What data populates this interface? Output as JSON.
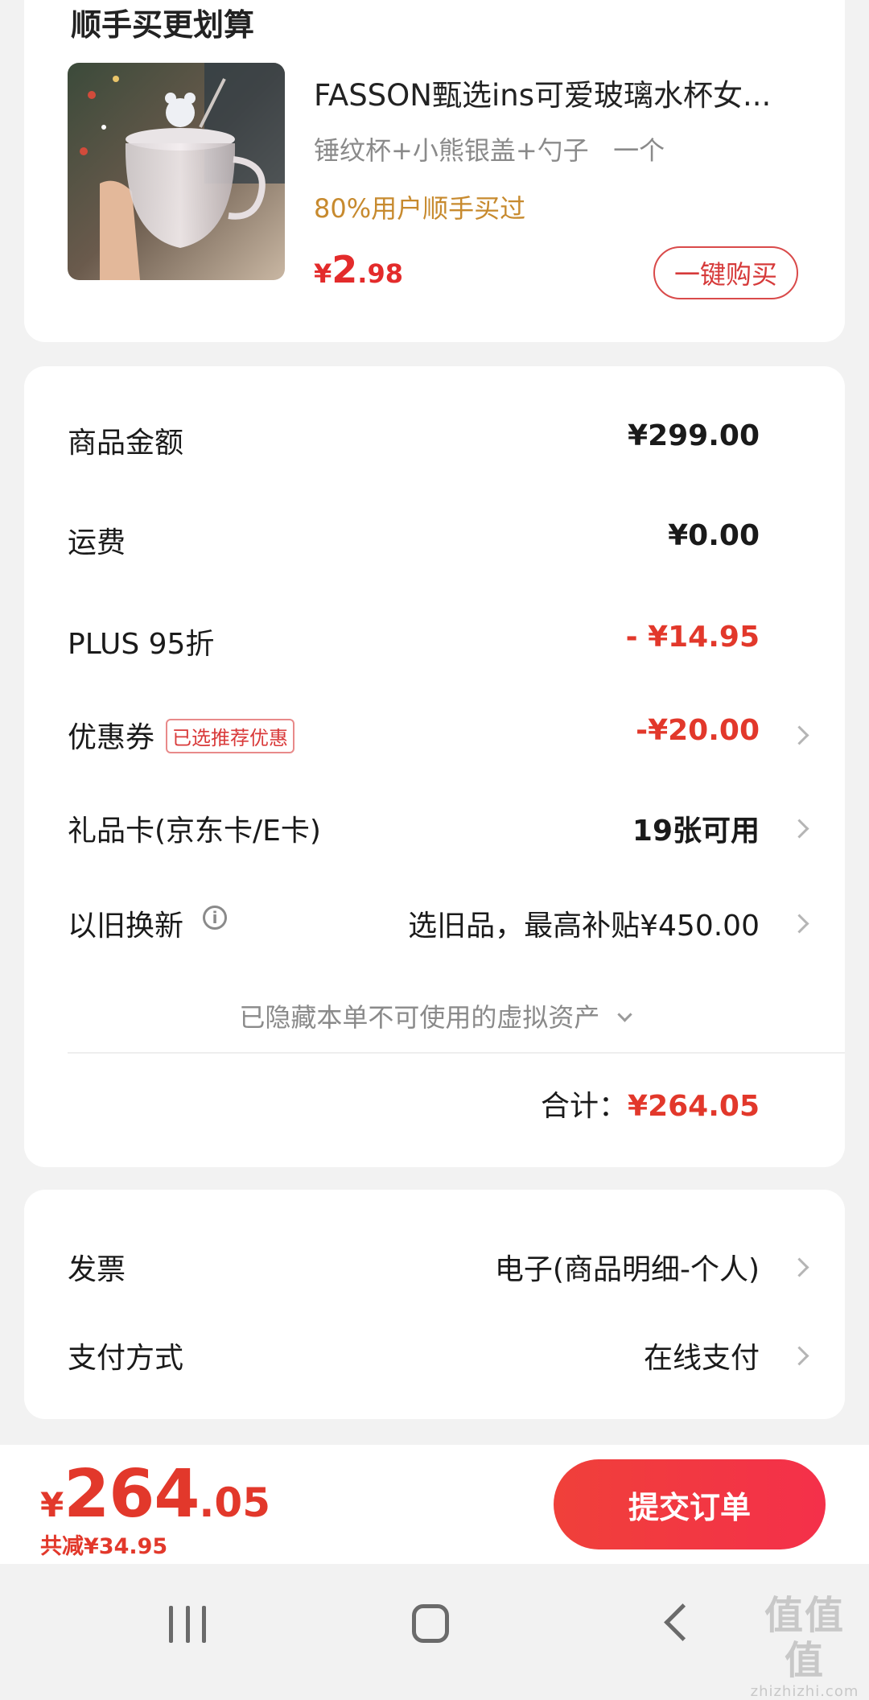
{
  "addon": {
    "section_title": "顺手买更划算",
    "product": {
      "name": "FASSON甄选ins可爱玻璃水杯女...",
      "spec": "锤纹杯+小熊银盖+勺子   一个",
      "social_proof": "80%用户顺手买过",
      "price_symbol": "¥",
      "price_integer": "2",
      "price_decimal": ".98",
      "buy_button": "一键购买"
    }
  },
  "summary": {
    "goods_amount": {
      "label": "商品金额",
      "value": "¥299.00"
    },
    "shipping": {
      "label": "运费",
      "value": "¥0.00"
    },
    "plus_discount": {
      "label": "PLUS 95折",
      "value": "- ¥14.95"
    },
    "coupon": {
      "label": "优惠券",
      "tag": "已选推荐优惠",
      "value": "-¥20.00"
    },
    "gift_card": {
      "label": "礼品卡(京东卡/E卡)",
      "value": "19张可用"
    },
    "trade_in": {
      "label": "以旧换新",
      "info_glyph": "i",
      "value": "选旧品，最高补贴¥450.00"
    },
    "hidden_assets": "已隐藏本单不可使用的虚拟资产",
    "total_label": "合计：",
    "total_value": "¥264.05"
  },
  "invoice": {
    "label": "发票",
    "value": "电子(商品明细-个人)"
  },
  "payment": {
    "label": "支付方式",
    "value": "在线支付"
  },
  "bottom_bar": {
    "price_symbol": "¥",
    "price_integer": "264",
    "price_decimal": ".05",
    "saved": "共减¥34.95",
    "submit_button": "提交订单"
  },
  "watermark": {
    "logo": "值值值",
    "url": "zhizhizhi.com"
  },
  "colors": {
    "accent_red": "#e2382b",
    "social_proof": "#c78a2e",
    "background": "#f2f2f2"
  }
}
